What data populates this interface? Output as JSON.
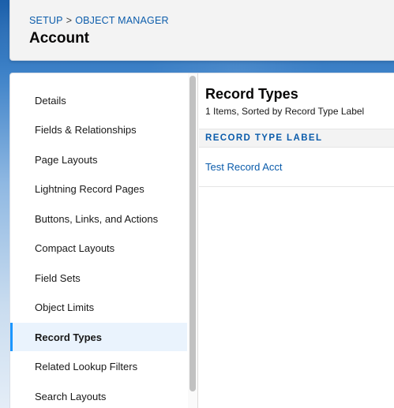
{
  "breadcrumb": {
    "items": [
      "SETUP",
      "OBJECT MANAGER"
    ],
    "separator": ">"
  },
  "header": {
    "title": "Account"
  },
  "sidebar": {
    "items": [
      {
        "label": "Details",
        "active": false
      },
      {
        "label": "Fields & Relationships",
        "active": false
      },
      {
        "label": "Page Layouts",
        "active": false
      },
      {
        "label": "Lightning Record Pages",
        "active": false
      },
      {
        "label": "Buttons, Links, and Actions",
        "active": false
      },
      {
        "label": "Compact Layouts",
        "active": false
      },
      {
        "label": "Field Sets",
        "active": false
      },
      {
        "label": "Object Limits",
        "active": false
      },
      {
        "label": "Record Types",
        "active": true
      },
      {
        "label": "Related Lookup Filters",
        "active": false
      },
      {
        "label": "Search Layouts",
        "active": false
      }
    ]
  },
  "main": {
    "title": "Record Types",
    "subtitle": "1 Items, Sorted by Record Type Label",
    "table": {
      "column_header": "RECORD TYPE LABEL",
      "rows": [
        {
          "label": "Test Record Acct"
        }
      ]
    }
  },
  "colors": {
    "link": "#0b5cab",
    "active_bg": "#eaf3fd",
    "active_border": "#1b96ff",
    "header_bg": "#f3f3f3"
  }
}
